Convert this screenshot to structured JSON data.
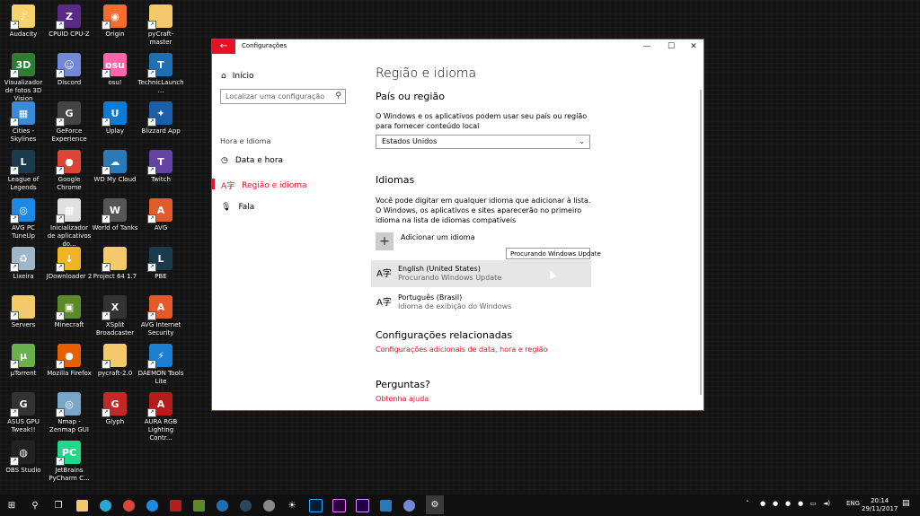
{
  "desktop": {
    "icons": [
      {
        "label": "Audacity",
        "color": "#f6d36b",
        "glyph": "♪"
      },
      {
        "label": "CPUID CPU-Z",
        "color": "#5b2a86",
        "glyph": "Z"
      },
      {
        "label": "Origin",
        "color": "#f56c2d",
        "glyph": "◉"
      },
      {
        "label": "pyCraft-master",
        "color": "#f3c96b",
        "glyph": ""
      },
      {
        "label": "Visualizador de fotos 3D Vision",
        "color": "#2e7d32",
        "glyph": "3D"
      },
      {
        "label": "Discord",
        "color": "#7289da",
        "glyph": "☺"
      },
      {
        "label": "osu!",
        "color": "#ff66aa",
        "glyph": "osu"
      },
      {
        "label": "TechnicLaunch...",
        "color": "#1f6fb5",
        "glyph": "T"
      },
      {
        "label": "Cities - Skylines",
        "color": "#3b8ad9",
        "glyph": "▦"
      },
      {
        "label": "GeForce Experience",
        "color": "#444",
        "glyph": "G"
      },
      {
        "label": "Uplay",
        "color": "#0a7bd6",
        "glyph": "U"
      },
      {
        "label": "Blizzard App",
        "color": "#1b5fa8",
        "glyph": "✦"
      },
      {
        "label": "League of Legends",
        "color": "#1c3a4d",
        "glyph": "L"
      },
      {
        "label": "Google Chrome",
        "color": "#db4437",
        "glyph": "●"
      },
      {
        "label": "WD My Cloud",
        "color": "#2a7ab9",
        "glyph": "☁"
      },
      {
        "label": "Twitch",
        "color": "#6441a5",
        "glyph": "T"
      },
      {
        "label": "AVG PC TuneUp",
        "color": "#1e88e5",
        "glyph": "◎"
      },
      {
        "label": "Inicializador de aplicativos do...",
        "color": "#e0e0e0",
        "glyph": "▦"
      },
      {
        "label": "World of Tanks",
        "color": "#555",
        "glyph": "W"
      },
      {
        "label": "AVG",
        "color": "#e35b2a",
        "glyph": "A"
      },
      {
        "label": "Lixeira",
        "color": "#9fb6c9",
        "glyph": "♻"
      },
      {
        "label": "JDownloader 2",
        "color": "#f0b429",
        "glyph": "↓"
      },
      {
        "label": "Project 64 1.7",
        "color": "#f3c96b",
        "glyph": ""
      },
      {
        "label": "PBE",
        "color": "#1c3a4d",
        "glyph": "L"
      },
      {
        "label": "Servers",
        "color": "#f3c96b",
        "glyph": ""
      },
      {
        "label": "Minecraft",
        "color": "#5c8a2a",
        "glyph": "▣"
      },
      {
        "label": "XSplit Broadcaster",
        "color": "#333",
        "glyph": "X"
      },
      {
        "label": "AVG Internet Security",
        "color": "#e35b2a",
        "glyph": "A"
      },
      {
        "label": "µTorrent",
        "color": "#6ab04c",
        "glyph": "µ"
      },
      {
        "label": "Mozilla Firefox",
        "color": "#e66000",
        "glyph": "●"
      },
      {
        "label": "pycraft-2.0",
        "color": "#f3c96b",
        "glyph": ""
      },
      {
        "label": "DAEMON Tools Lite",
        "color": "#1d7fd1",
        "glyph": "⚡"
      },
      {
        "label": "ASUS GPU Tweak!!",
        "color": "#333",
        "glyph": "G"
      },
      {
        "label": "Nmap - Zenmap GUI",
        "color": "#7aa7c7",
        "glyph": "◎"
      },
      {
        "label": "Glyph",
        "color": "#c62828",
        "glyph": "G"
      },
      {
        "label": "AURA RGB Lighting Contr...",
        "color": "#b71c1c",
        "glyph": "A"
      },
      {
        "label": "OBS Studio",
        "color": "#222",
        "glyph": "◍"
      },
      {
        "label": "JetBrains PyCharm C...",
        "color": "#21d789",
        "glyph": "PC"
      }
    ]
  },
  "window": {
    "title": "Configurações",
    "nav": {
      "home": "Início",
      "search_placeholder": "Localizar uma configuração",
      "group": "Hora e Idioma",
      "items": [
        {
          "label": "Data e hora",
          "icon": "clock-icon"
        },
        {
          "label": "Região e idioma",
          "icon": "region-icon"
        },
        {
          "label": "Fala",
          "icon": "microphone-icon"
        }
      ]
    },
    "main": {
      "title": "Região e idioma",
      "country_heading": "País ou região",
      "country_desc": "O Windows e os aplicativos podem usar seu país ou região para fornecer conteúdo local",
      "country_value": "Estados Unidos",
      "languages_heading": "Idiomas",
      "languages_desc": "Você pode digitar em qualquer idioma que adicionar à lista. O Windows, os aplicativos e sites aparecerão no primeiro idioma na lista de idiomas compatíveis",
      "add_language": "Adicionar um idioma",
      "languages": [
        {
          "name": "English (United States)",
          "status": "Procurando Windows Update"
        },
        {
          "name": "Português (Brasil)",
          "status": "Idioma de exibição do Windows"
        }
      ],
      "related_heading": "Configurações relacionadas",
      "related_link": "Configurações adicionais de data, hora e região",
      "questions_heading": "Perguntas?",
      "help_link": "Obtenha ajuda"
    },
    "tooltip": "Procurando Windows Update"
  },
  "taskbar": {
    "language": "ENG",
    "time": "20:14",
    "date": "29/11/2017"
  }
}
